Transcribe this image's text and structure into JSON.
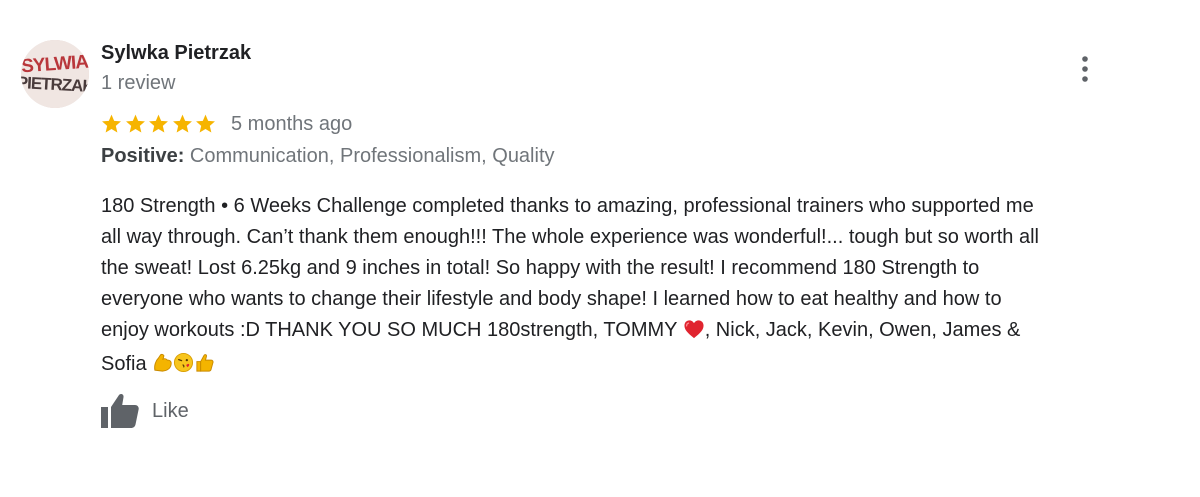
{
  "review": {
    "author": {
      "name": "Sylwka Pietrzak",
      "review_count": "1 review",
      "avatar_text_line1": "SYLWIA",
      "avatar_text_line2": "PIETRZAK",
      "avatar_colors": [
        "#b3262b",
        "#3a2b2b"
      ]
    },
    "rating": {
      "stars": 5,
      "max": 5,
      "star_color": "#f6b400"
    },
    "date": "5 months ago",
    "positive": {
      "label": "Positive:",
      "value": "Communication, Professionalism, Quality"
    },
    "text_lines": [
      "180 Strength • 6 Weeks Challenge completed thanks to amazing, professional trainers who supported me",
      "all way through. Can’t thank them enough!!! The whole experience was wonderful!... tough but so worth all",
      "the sweat! Lost 6.25kg and 9 inches in total! So happy with the result! I recommend 180 Strength to",
      "everyone who wants to change their lifestyle and body shape! I learned how to eat healthy and how to",
      "enjoy workouts :D THANK YOU SO MUCH 180strength, TOMMY",
      ", Nick, Jack, Kevin, Owen, James &",
      "Sofia"
    ],
    "emojis": {
      "heart": "red-heart-icon",
      "trailing": [
        "flexed-biceps-icon",
        "face-blowing-kiss-icon",
        "thumbs-up-emoji-icon"
      ]
    },
    "actions": {
      "like_label": "Like",
      "more_icon": "more-vert-icon"
    }
  }
}
